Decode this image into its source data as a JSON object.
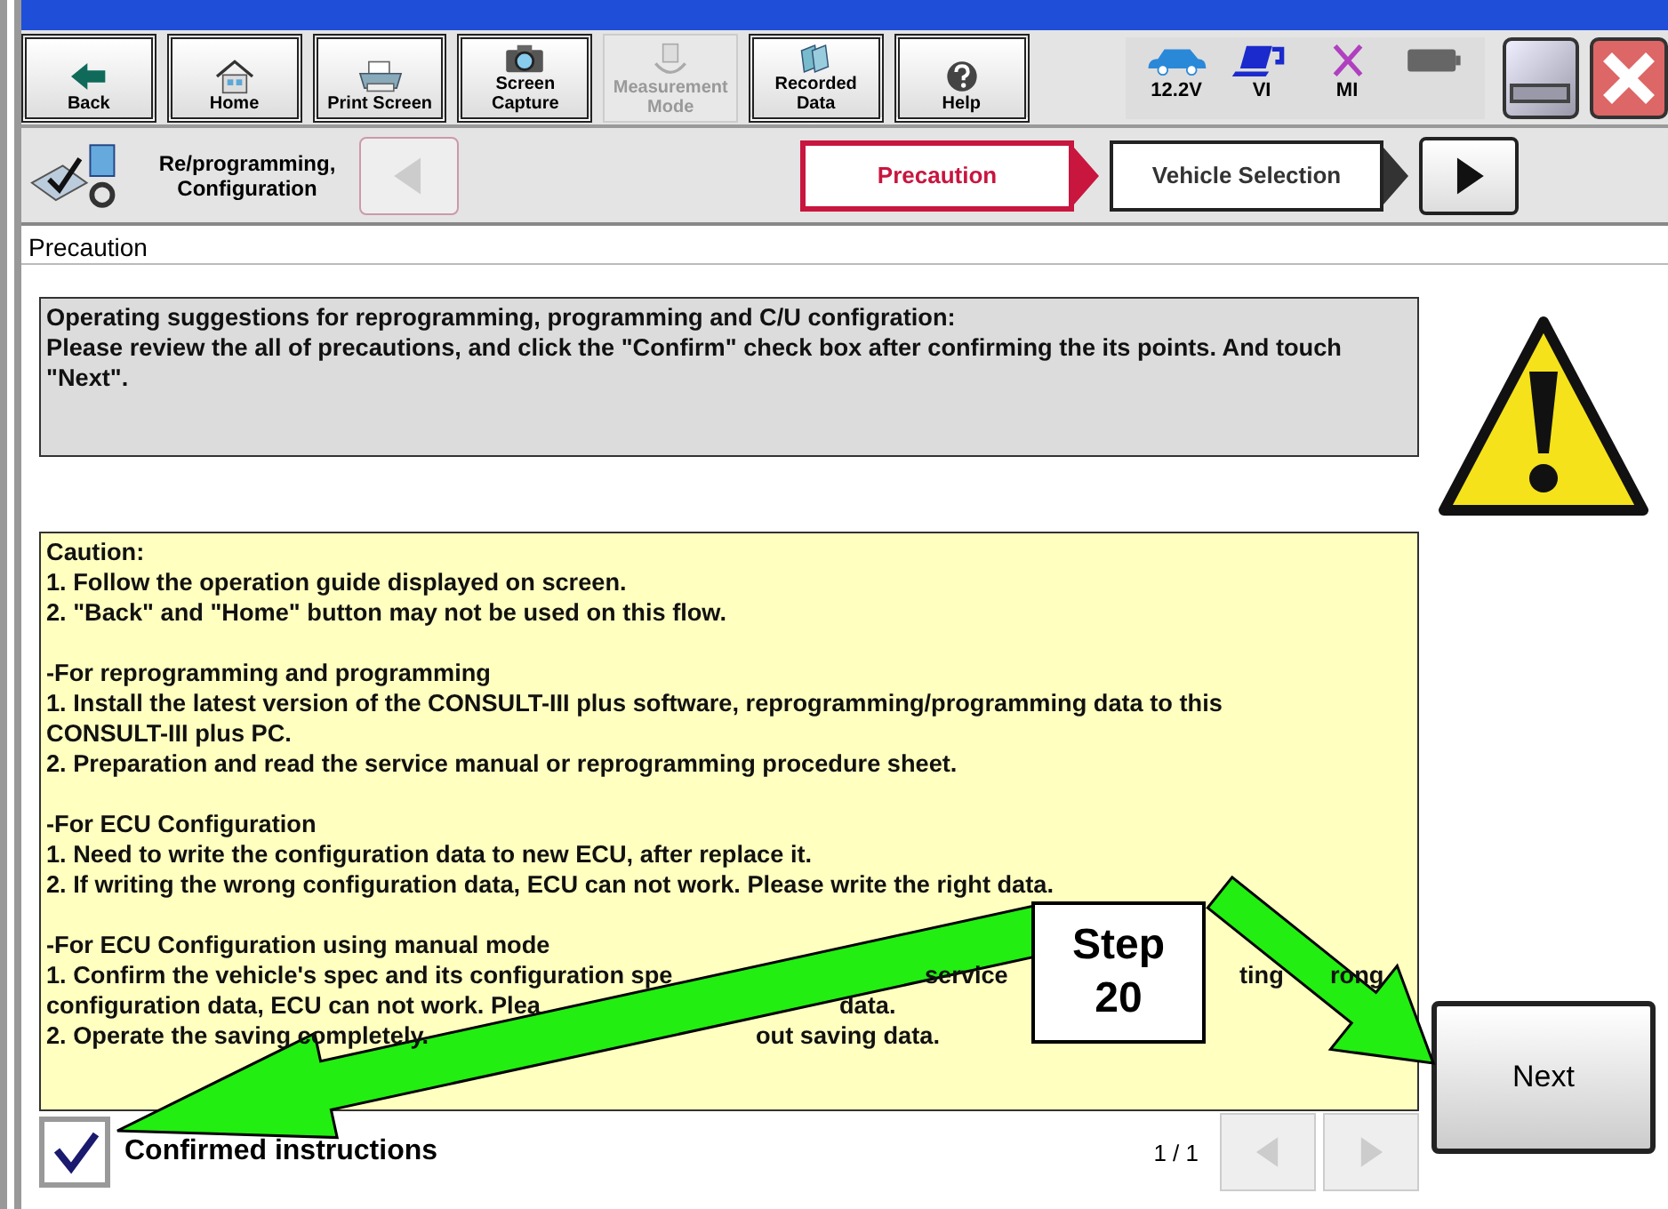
{
  "toolbar": {
    "buttons": [
      {
        "label": "Back",
        "disabled": false
      },
      {
        "label": "Home",
        "disabled": false
      },
      {
        "label": "Print Screen",
        "disabled": false
      },
      {
        "label": "Screen Capture",
        "disabled": false
      },
      {
        "label": "Measurement Mode",
        "disabled": true
      },
      {
        "label": "Recorded Data",
        "disabled": false
      },
      {
        "label": "Help",
        "disabled": false
      }
    ]
  },
  "status": {
    "indicators": [
      {
        "label": "12.2V"
      },
      {
        "label": "VI"
      },
      {
        "label": "MI"
      }
    ]
  },
  "nav": {
    "title": "Re/programming, Configuration",
    "back_disabled": true,
    "steps": [
      {
        "label": "Precaution",
        "selected": true
      },
      {
        "label": "Vehicle Selection",
        "selected": false
      }
    ]
  },
  "section_title": "Precaution",
  "instructions": [
    "Operating suggestions for reprogramming, programming and C/U configration:",
    "Please review the all of precautions, and click the \"Confirm\" check box after confirming the its points. And touch \"Next\"."
  ],
  "caution": [
    [
      [
        "Caution:"
      ],
      [
        "1. Follow the operation guide displayed on screen."
      ],
      [
        "2. \"Back\" and  \"Home\" button may not be used on this flow."
      ]
    ],
    [
      [
        "-For reprogramming and programming"
      ],
      [
        "1. Install the latest version of the CONSULT-III plus software, reprogramming/programming data to this"
      ],
      [
        "CONSULT-III plus PC."
      ],
      [
        "2. Preparation and read the service manual or reprogramming procedure sheet."
      ]
    ],
    [
      [
        "-For ECU Configuration"
      ],
      [
        "1. Need to write the configuration data to new ECU, after replace it."
      ],
      [
        "2. If writing the wrong configuration data, ECU can not work. Please write the right data."
      ]
    ],
    [
      [
        "-For ECU Configuration using manual mode"
      ],
      [
        "1. Confirm the vehicle's spec and its configuration spe",
        "service",
        "ting",
        "rong"
      ],
      [
        "configuration data, ECU can not work. Plea",
        "data."
      ],
      [
        "2. Operate the saving completely.",
        "out saving data."
      ]
    ]
  ],
  "confirm": {
    "label": "Confirmed instructions",
    "checked": true
  },
  "page_indicator": "1 / 1",
  "next_button": "Next",
  "callout": [
    "Step",
    "20"
  ]
}
